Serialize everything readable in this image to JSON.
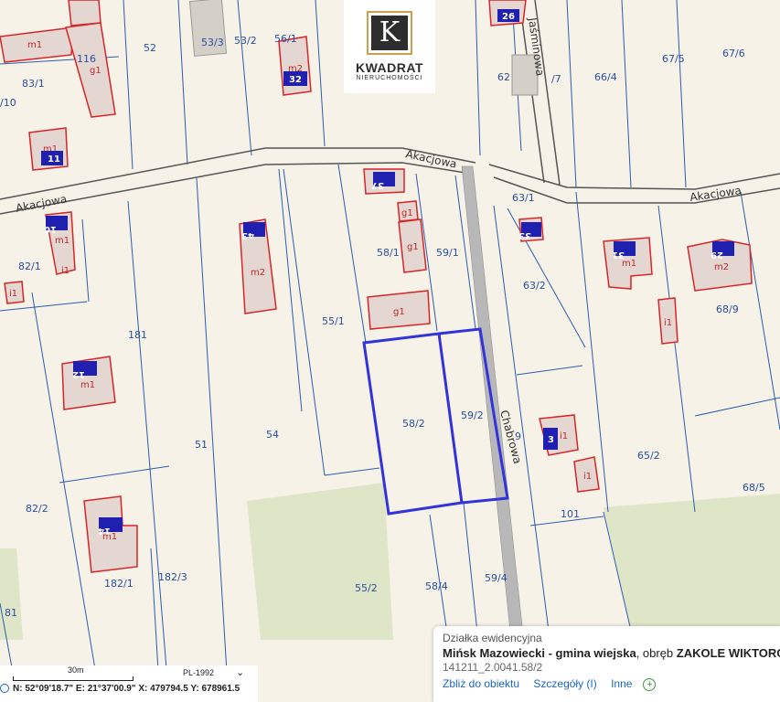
{
  "map": {
    "roads": {
      "akacjowa_1": "Akacjowa",
      "akacjowa_2": "Akacjowa",
      "akacjowa_3": "Akacjowa",
      "jasminowa": "Jaśminowa",
      "chabrowa": "Chabrowa"
    },
    "parcels": {
      "p52": "52",
      "p53_3": "53/3",
      "p53_2": "53/2",
      "p56_1": "56/1",
      "p83_1": "83/1",
      "p10": "/10",
      "p116": "116",
      "p62": "62",
      "p66_4": "66/4",
      "p67_5": "67/5",
      "p67_6": "67/6",
      "p7": "/7",
      "p63_1": "63/1",
      "p58_1": "58/1",
      "p59_1": "59/1",
      "p82_1": "82/1",
      "p63_2": "63/2",
      "p68_9": "68/9",
      "p181": "181",
      "p55_1": "55/1",
      "p58_2": "58/2",
      "p59_2": "59/2",
      "p51": "51",
      "p54": "54",
      "p9": "9",
      "p65_2": "65/2",
      "p68_5": "68/5",
      "p101": "101",
      "p82_2": "82/2",
      "p182_1": "182/1",
      "p182_3": "182/3",
      "p55_2": "55/2",
      "p58_4": "58/4",
      "p59_4": "59/4",
      "p81": "81"
    },
    "buildings": {
      "m1_a": "m1",
      "g1_a": "g1",
      "m2_a": "m2",
      "m1_b": "m1",
      "m1_c": "m1",
      "i1_a": "i1",
      "i1_b": "i1",
      "m2_b": "m2",
      "g1_b": "g1",
      "g1_c": "g1",
      "g1_d": "g1",
      "m1_d": "m1",
      "m2_c": "m2",
      "i1_c": "i1",
      "m1_e": "m1",
      "i1_d": "i1",
      "i1_e": "i1",
      "m1_f": "m1",
      "m2_d": "m2"
    },
    "house_numbers": {
      "n26": "26",
      "n32": "32",
      "n11": "11",
      "n37": "37",
      "n10": "10",
      "n43": "43",
      "n33": "33",
      "n31": "31",
      "n29": "29",
      "n12": "12",
      "n3": "3",
      "n14": "14"
    }
  },
  "logo": {
    "letter": "K",
    "brand": "KWADRAT",
    "sub": "NIERUCHOMOŚCI"
  },
  "info": {
    "title": "Działka ewidencyjna",
    "municipality": "Mińsk Mazowiecki - gmina wiejska",
    "precinct_prefix": ", obręb ",
    "precinct": "ZAKOLE WIKTOROWO",
    "parcel_id": "141211_2.0041.58/2",
    "zoom_link": "Zbliż do obiektu",
    "details_link": "Szczegóły (I)",
    "other_link": "Inne"
  },
  "scale": {
    "bar_label": "30m",
    "crs": "PL-1992",
    "coordinates": "N: 52°09'18.7\"  E: 21°37'00.9\"  X: 479794.5   Y: 678961.5"
  },
  "colors": {
    "parcel_line": "#2a5db0",
    "building": "#d8252a",
    "selection": "#3333dd",
    "road": "#666666"
  }
}
